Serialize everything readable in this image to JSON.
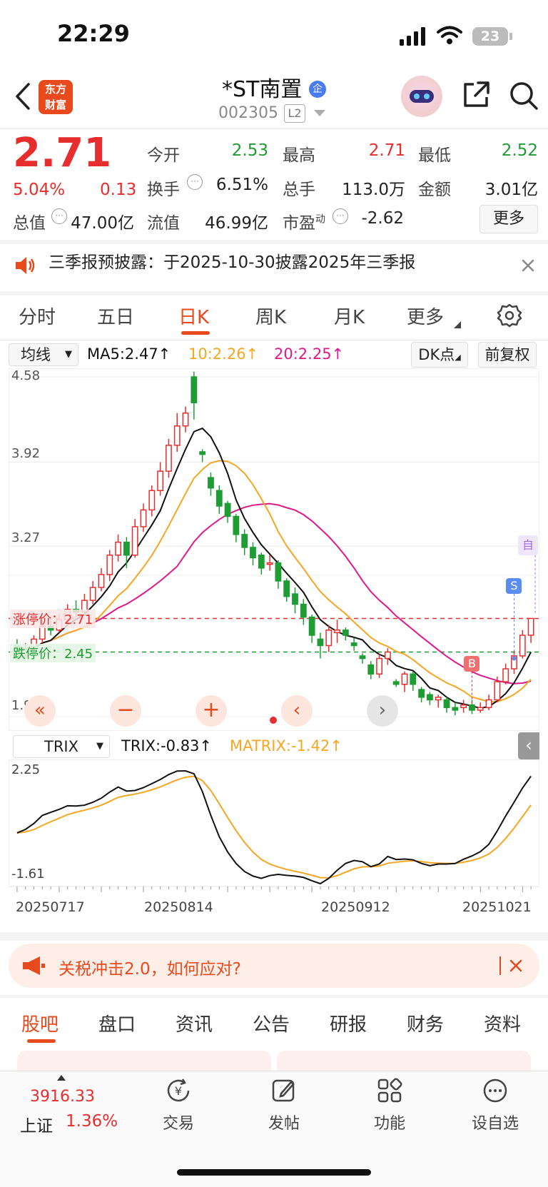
{
  "status": {
    "time": "22:29",
    "battery": "23"
  },
  "header": {
    "logo_line1": "东方",
    "logo_line2": "财富",
    "stock_name": "*ST南置",
    "stock_code": "002305",
    "level_badge": "L2",
    "name_badge": "企"
  },
  "quote": {
    "price": "2.71",
    "change_pct": "5.04%",
    "change": "0.13",
    "open_label": "今开",
    "open": "2.53",
    "high_label": "最高",
    "high": "2.71",
    "low_label": "最低",
    "low": "2.52",
    "turnover_label": "换手",
    "turnover": "6.51%",
    "volume_label": "总手",
    "volume": "113.0万",
    "amount_label": "金额",
    "amount": "3.01亿",
    "mktcap_label": "总值",
    "mktcap": "47.00亿",
    "float_label": "流值",
    "float_cap": "46.99亿",
    "pe_label": "市盈",
    "pe_sup": "动",
    "pe": "-2.62",
    "more_label": "更多"
  },
  "notice": {
    "text": "三季报预披露：于2025-10-30披露2025年三季报"
  },
  "ktabs": [
    "分时",
    "五日",
    "日K",
    "周K",
    "月K",
    "更多"
  ],
  "chart_toolbar": {
    "ma_selector": "均线",
    "ma5": "MA5:2.47↑",
    "ma10": "10:2.26↑",
    "ma20": "20:2.25↑",
    "dk_button": "DK点",
    "adjust_button": "前复权"
  },
  "indicator": {
    "selector": "TRIX",
    "trix": "TRIX:-0.83↑",
    "matrix": "MATRIX:-1.42↑"
  },
  "chart_data": {
    "type": "candlestick",
    "y_ticks": [
      "4.58",
      "3.92",
      "3.27",
      "1.95"
    ],
    "ylim": [
      1.95,
      4.58
    ],
    "limit_up_label": "涨停价：2.71",
    "limit_down_label": "跌停价：2.45",
    "limit_up": 2.71,
    "limit_down": 2.45,
    "markers": {
      "buy": "B",
      "sell": "S",
      "self": "自"
    },
    "trix_ticks": [
      "2.25",
      "-1.61"
    ],
    "x_ticks": [
      "20250717",
      "20250814",
      "20250912",
      "20251021"
    ],
    "candles": [
      [
        2.5,
        2.4,
        2.55,
        2.38
      ],
      [
        2.42,
        2.48,
        2.52,
        2.4
      ],
      [
        2.48,
        2.55,
        2.58,
        2.45
      ],
      [
        2.55,
        2.65,
        2.7,
        2.52
      ],
      [
        2.65,
        2.62,
        2.72,
        2.58
      ],
      [
        2.62,
        2.7,
        2.75,
        2.6
      ],
      [
        2.7,
        2.78,
        2.82,
        2.66
      ],
      [
        2.78,
        2.76,
        2.85,
        2.72
      ],
      [
        2.76,
        2.85,
        2.9,
        2.74
      ],
      [
        2.85,
        2.95,
        3.0,
        2.82
      ],
      [
        2.95,
        3.05,
        3.1,
        2.92
      ],
      [
        3.05,
        3.2,
        3.24,
        3.0
      ],
      [
        3.2,
        3.3,
        3.36,
        3.15
      ],
      [
        3.3,
        3.2,
        3.34,
        3.1
      ],
      [
        3.2,
        3.42,
        3.48,
        3.18
      ],
      [
        3.42,
        3.55,
        3.6,
        3.38
      ],
      [
        3.55,
        3.7,
        3.74,
        3.5
      ],
      [
        3.7,
        3.85,
        3.92,
        3.66
      ],
      [
        3.85,
        4.05,
        4.1,
        3.8
      ],
      [
        4.05,
        4.2,
        4.3,
        4.0
      ],
      [
        4.2,
        4.3,
        4.35,
        4.15
      ],
      [
        4.58,
        4.38,
        4.62,
        4.25
      ],
      [
        4.0,
        3.98,
        4.02,
        3.92
      ],
      [
        3.8,
        3.72,
        3.84,
        3.66
      ],
      [
        3.7,
        3.58,
        3.74,
        3.52
      ],
      [
        3.6,
        3.5,
        3.62,
        3.45
      ],
      [
        3.5,
        3.36,
        3.52,
        3.3
      ],
      [
        3.36,
        3.26,
        3.4,
        3.2
      ],
      [
        3.26,
        3.18,
        3.3,
        3.12
      ],
      [
        3.2,
        3.1,
        3.22,
        3.05
      ],
      [
        3.14,
        3.14,
        3.2,
        3.08
      ],
      [
        3.14,
        3.0,
        3.16,
        2.94
      ],
      [
        3.0,
        2.88,
        3.02,
        2.84
      ],
      [
        2.9,
        2.82,
        2.95,
        2.75
      ],
      [
        2.82,
        2.72,
        2.86,
        2.66
      ],
      [
        2.72,
        2.58,
        2.74,
        2.52
      ],
      [
        2.55,
        2.5,
        2.6,
        2.4
      ],
      [
        2.5,
        2.62,
        2.66,
        2.45
      ],
      [
        2.6,
        2.62,
        2.7,
        2.52
      ],
      [
        2.62,
        2.58,
        2.64,
        2.54
      ],
      [
        2.52,
        2.5,
        2.56,
        2.46
      ],
      [
        2.42,
        2.4,
        2.44,
        2.36
      ],
      [
        2.35,
        2.28,
        2.38,
        2.24
      ],
      [
        2.28,
        2.4,
        2.44,
        2.25
      ],
      [
        2.4,
        2.45,
        2.48,
        2.35
      ],
      [
        2.22,
        2.2,
        2.24,
        2.18
      ],
      [
        2.2,
        2.28,
        2.3,
        2.14
      ],
      [
        2.28,
        2.2,
        2.3,
        2.15
      ],
      [
        2.16,
        2.1,
        2.18,
        2.06
      ],
      [
        2.12,
        2.08,
        2.14,
        2.04
      ],
      [
        2.08,
        2.1,
        2.12,
        2.02
      ],
      [
        2.08,
        2.02,
        2.1,
        1.98
      ],
      [
        2.02,
        2.0,
        2.06,
        1.96
      ],
      [
        2.02,
        2.04,
        2.08,
        1.98
      ],
      [
        2.04,
        2.0,
        2.08,
        1.97
      ],
      [
        2.0,
        2.02,
        2.06,
        1.98
      ],
      [
        2.02,
        2.08,
        2.12,
        2.0
      ],
      [
        2.08,
        2.22,
        2.26,
        2.06
      ],
      [
        2.22,
        2.32,
        2.36,
        2.2
      ],
      [
        2.32,
        2.42,
        2.46,
        2.28
      ],
      [
        2.42,
        2.58,
        2.62,
        2.4
      ],
      [
        2.58,
        2.71,
        2.71,
        2.52
      ]
    ]
  },
  "promo": {
    "text": "关税冲击2.0，如何应对?"
  },
  "info_tabs": [
    "股吧",
    "盘口",
    "资讯",
    "公告",
    "研报",
    "财务",
    "资料"
  ],
  "bottom_nav": {
    "index_value": "3916.33",
    "index_name": "上证",
    "index_change": "1.36%",
    "items": [
      "交易",
      "发帖",
      "功能",
      "设自选"
    ]
  },
  "colors": {
    "up": "#e62e2e",
    "down": "#1f9d34",
    "brand": "#e8491d",
    "ma5": "#111111",
    "ma10": "#f5a623",
    "ma20": "#e0198a"
  }
}
